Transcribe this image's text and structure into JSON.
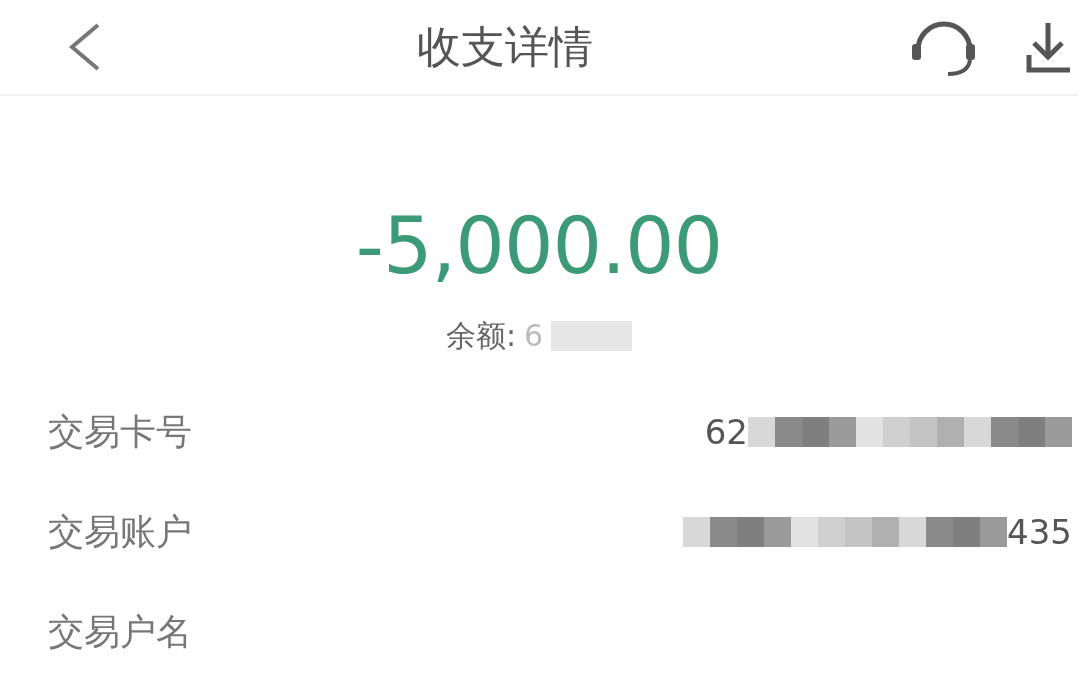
{
  "header": {
    "title": "收支详情"
  },
  "amount": "-5,000.00",
  "balance": {
    "label": "余额:",
    "value": "6"
  },
  "rows": [
    {
      "label": "交易卡号",
      "value": "62",
      "kind": "leading"
    },
    {
      "label": "交易账户",
      "value": "435",
      "kind": "trailing"
    },
    {
      "label": "交易户名"
    }
  ]
}
